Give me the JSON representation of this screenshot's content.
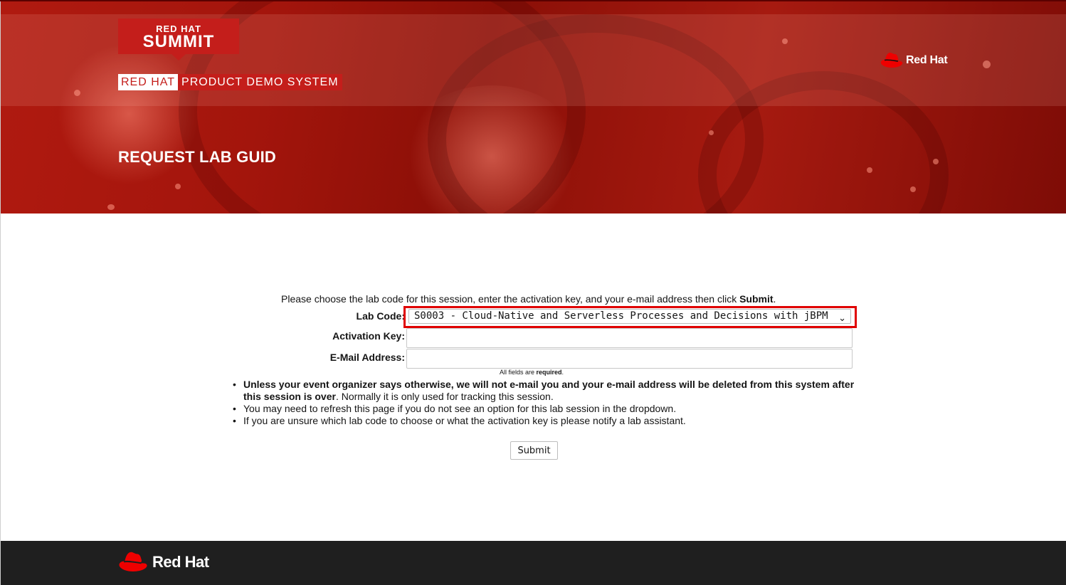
{
  "header": {
    "summit_badge": {
      "line1": "RED HAT",
      "line2": "SUMMIT"
    },
    "demo_banner": {
      "part1": "RED HAT",
      "part2": "PRODUCT DEMO SYSTEM"
    },
    "brand_top": "Red Hat",
    "page_title": "REQUEST LAB GUID"
  },
  "form": {
    "intro_prefix": "Please choose the lab code for this session, enter the activation key, and your e-mail address then click ",
    "intro_bold": "Submit",
    "intro_suffix": ".",
    "lab_code_label": "Lab Code:",
    "lab_code_value": "S0003 - Cloud-Native and Serverless Processes and Decisions with jBPM",
    "activation_key_label": "Activation Key:",
    "activation_key_value": "",
    "email_label": "E-Mail Address:",
    "email_value": "",
    "required_prefix": "All fields are ",
    "required_bold": "required",
    "required_suffix": ".",
    "submit_label": "Submit"
  },
  "notes": {
    "note1_bold": "Unless your event organizer says otherwise, we will not e-mail you and your e-mail address will be deleted from this system after this session is over",
    "note1_rest": ". Normally it is only used for tracking this session.",
    "note2": "You may need to refresh this page if you do not see an option for this lab session in the dropdown.",
    "note3": "If you are unsure which lab code to choose or what the activation key is please notify a lab assistant."
  },
  "footer": {
    "brand": "Red Hat"
  },
  "colors": {
    "brand_red": "#c41e1b",
    "highlight": "#e00000",
    "footer_bg": "#1f1f1f"
  },
  "icons": {
    "logo": "red-hat-fedora-icon",
    "select": "chevron-down-icon"
  }
}
